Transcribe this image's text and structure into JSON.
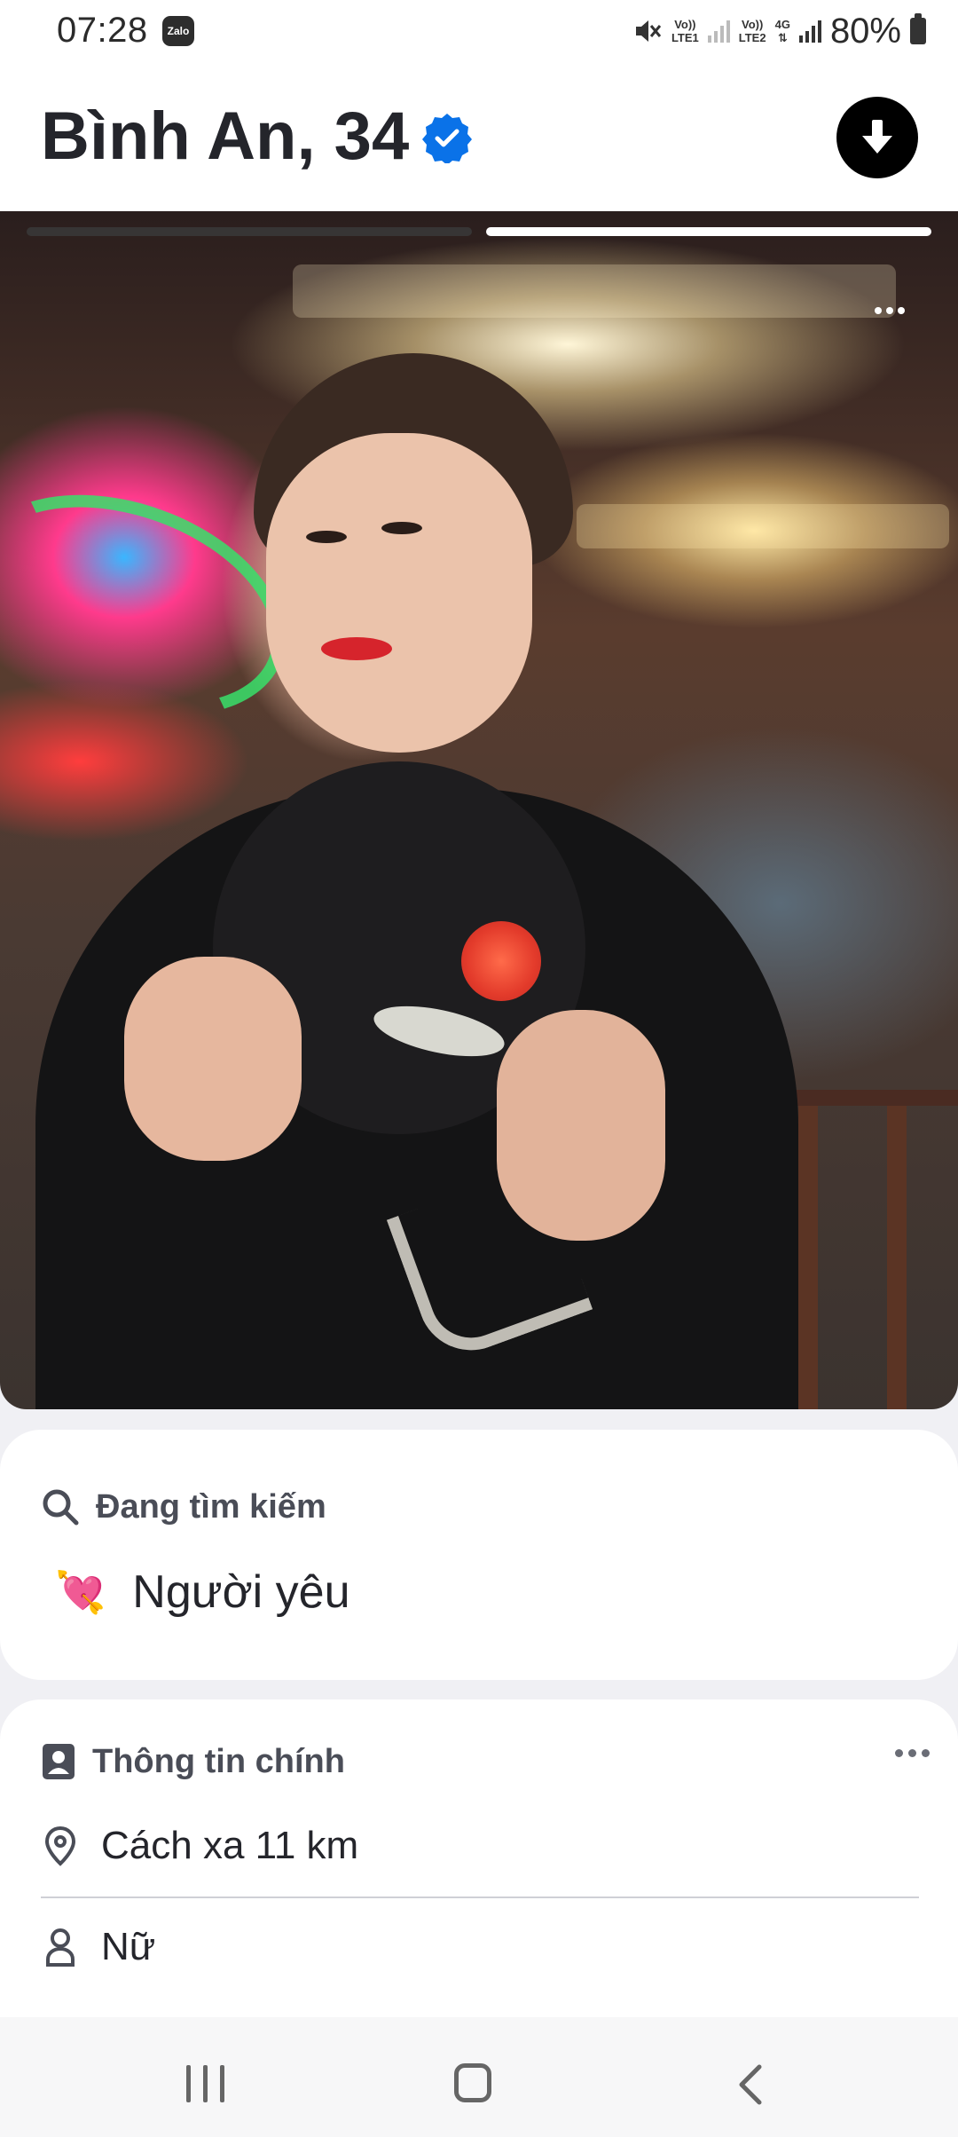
{
  "status_bar": {
    "time": "07:28",
    "app_badge": "Zalo",
    "sim1_label_top": "Vo))",
    "sim1_label_bottom": "LTE1",
    "sim2_label_top": "Vo))",
    "sim2_label_bottom": "LTE2",
    "network_type": "4G",
    "battery": "80%",
    "icons": [
      "mute-icon",
      "signal-icon",
      "battery-icon"
    ]
  },
  "profile": {
    "name_age": "Bình An, 34",
    "verified": true,
    "accent_color": "#0a72e8",
    "photo_count": 2,
    "current_photo": 2
  },
  "looking_for": {
    "header": "Đang tìm kiếm",
    "emoji": "💘",
    "value": "Người yêu"
  },
  "main_info": {
    "header": "Thông tin chính",
    "distance": "Cách xa 11 km",
    "gender": "Nữ"
  }
}
